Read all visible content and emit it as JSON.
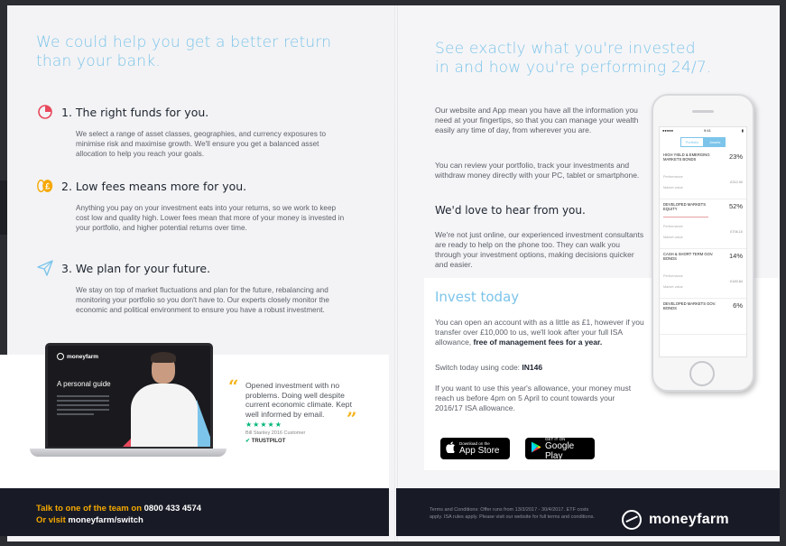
{
  "left_page": {
    "title": "We could help you get a better return than your bank.",
    "sections": [
      {
        "icon": "pie-chart-icon",
        "title": "1. The right funds for you.",
        "body": "We select a range of asset classes, geographies, and currency exposures to minimise risk and maximise growth. We'll ensure you get a balanced asset allocation to help you reach your goals."
      },
      {
        "icon": "pound-coins-icon",
        "title": "2. Low fees means more for you.",
        "body": "Anything you pay on your investment eats into your returns, so we work to keep cost low and quality high. Lower fees mean that more of your money is invested in your portfolio, and higher potential returns over time."
      },
      {
        "icon": "paper-plane-icon",
        "title": "3. We plan for your future.",
        "body": "We stay on top of market fluctuations and plan for the future, rebalancing and monitoring your portfolio so you don't have to. Our experts closely monitor the economic and political environment to ensure you have a robust investment."
      }
    ],
    "laptop": {
      "brand": "moneyfarm",
      "title": "A personal guide"
    },
    "review": {
      "text": "Opened investment with no problems. Doing well despite current economic climate. Kept well informed by email.",
      "stars": "★★★★★",
      "author": "Bill Stanley 2016 Customer",
      "source": "TRUSTPILOT"
    },
    "footer": {
      "line1_prefix": "Talk to one of the team on",
      "phone": "0800 433 4574",
      "line2_prefix": "Or visit",
      "url": "moneyfarm/switch"
    }
  },
  "right_page": {
    "title": "See exactly what you're invested in and how you're performing 24/7.",
    "para1": "Our website and App mean you have all the information you need at your fingertips, so that you can manage your wealth easily any time of day, from wherever you are.",
    "para2": "You can review your portfolio, track your investments and withdraw money directly with your PC, tablet or smartphone.",
    "love_title": "We'd love to hear from you.",
    "para3": "We're not just online, our experienced investment consultants are ready to help on the phone too. They can walk you through your investment options, making decisions quicker and easier.",
    "invest": {
      "title": "Invest today",
      "para1_prefix": "You can open an account with as a little as £1, however if you transfer over £10,000 to us, we'll look after your full ISA allowance,",
      "para1_bold": "free of management fees for a year.",
      "code_prefix": "Switch today using code:",
      "code": "IN146",
      "para3": "If you want to use this year's allowance, your money must reach us before 4pm on 5 April to count towards your 2016/17 ISA allowance."
    },
    "app_store": {
      "small": "Download on the",
      "big": "App Store"
    },
    "google_play": {
      "small": "GET IT ON",
      "big": "Google Play"
    },
    "phone": {
      "tabs": [
        "Portfolio",
        "Assets"
      ],
      "rows": [
        {
          "name": "HIGH YIELD & EMERGING MARKETS BONDS",
          "pct": "23%",
          "value": "£312.00"
        },
        {
          "name": "DEVELOPED MARKETS EQUITY",
          "pct": "52%",
          "value": "£706.10"
        },
        {
          "name": "CASH & SHORT TERM GOV. BONDS",
          "pct": "14%",
          "value": "£183.84"
        },
        {
          "name": "DEVELOPED MARKETS GOV. BONDS",
          "pct": "6%",
          "value": ""
        }
      ],
      "row_meta": [
        "Performance",
        "Market value"
      ]
    },
    "footer": {
      "terms": "Terms and Conditions: Offer runs from 13/3/2017 - 30/4/2017. ETF costs apply. ISA rules apply. Please visit our website for full terms and conditions.",
      "brand": "moneyfarm"
    }
  },
  "colors": {
    "accent_blue": "#7cc4ea",
    "footer_bg": "#181b26",
    "highlight_orange": "#f5a800",
    "icon_red": "#e8495d"
  }
}
